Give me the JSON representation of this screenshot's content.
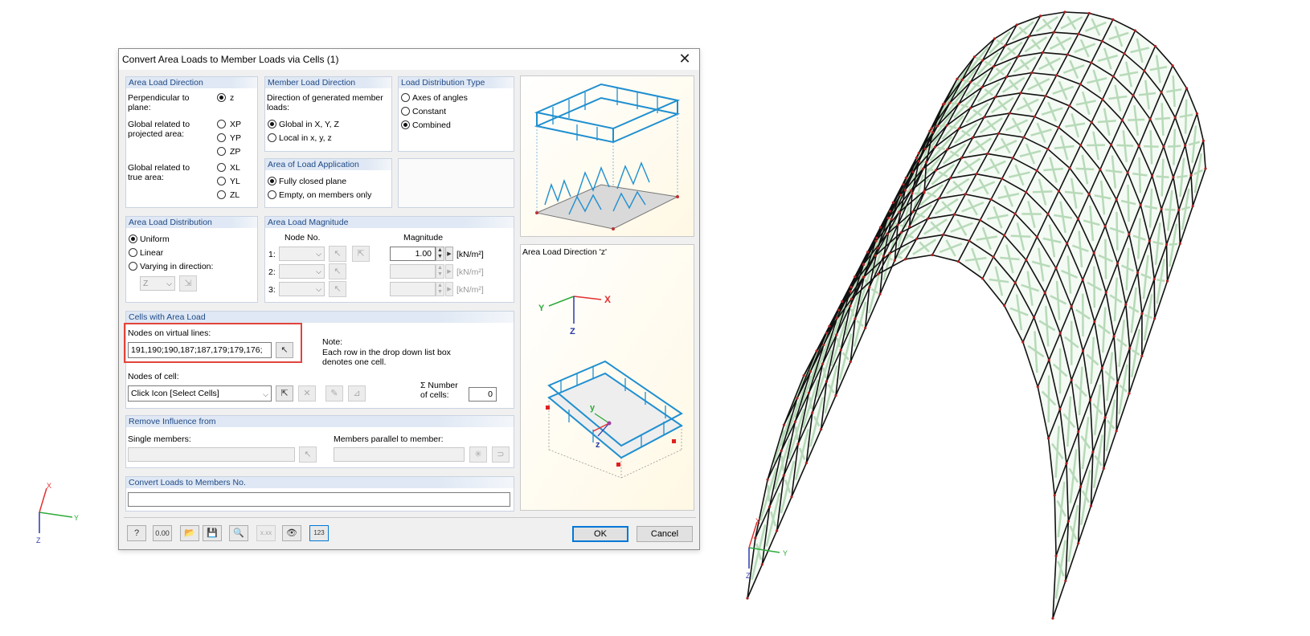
{
  "dialog": {
    "title": "Convert Area Loads to Member Loads via Cells   (1)",
    "close_glyph": "✕"
  },
  "area_load_direction": {
    "header": "Area Load Direction",
    "perpendicular_label": "Perpendicular to plane:",
    "z_option": "z",
    "global_projected_label": "Global related to projected area:",
    "projected_options": [
      "XP",
      "YP",
      "ZP"
    ],
    "global_true_label": "Global related to true area:",
    "true_options": [
      "XL",
      "YL",
      "ZL"
    ],
    "selected": "z"
  },
  "member_load_direction": {
    "header": "Member Load Direction",
    "description": "Direction of generated member loads:",
    "options": [
      "Global in X, Y, Z",
      "Local in x, y, z"
    ],
    "selected": "Global in X, Y, Z"
  },
  "load_distribution_type": {
    "header": "Load Distribution Type",
    "options": [
      "Axes of angles",
      "Constant",
      "Combined"
    ],
    "selected": "Combined"
  },
  "area_of_load_application": {
    "header": "Area of Load Application",
    "options": [
      "Fully closed plane",
      "Empty, on members only"
    ],
    "selected": "Fully closed plane"
  },
  "area_load_distribution": {
    "header": "Area Load Distribution",
    "options": [
      "Uniform",
      "Linear",
      "Varying in direction:"
    ],
    "selected": "Uniform",
    "direction_value": "Z"
  },
  "area_load_magnitude": {
    "header": "Area Load Magnitude",
    "node_no_header": "Node No.",
    "magnitude_header": "Magnitude",
    "rows": [
      {
        "index": "1:",
        "magnitude": "1.00",
        "unit": "[kN/m²]"
      },
      {
        "index": "2:",
        "magnitude": "",
        "unit": "[kN/m²]"
      },
      {
        "index": "3:",
        "magnitude": "",
        "unit": "[kN/m²]"
      }
    ]
  },
  "cells_with_area_load": {
    "header": "Cells with Area Load",
    "nodes_virtual_label": "Nodes on virtual lines:",
    "nodes_virtual_value": "191,190;190,187;187,179;179,176;",
    "note_title": "Note:",
    "note_text_1": "Each row in the drop down list box",
    "note_text_2": "denotes one cell.",
    "nodes_of_cell_label": "Nodes of cell:",
    "nodes_of_cell_value": "Click Icon [Select Cells]",
    "number_label_1": "Σ Number",
    "number_label_2": "of cells:",
    "number_value": "0"
  },
  "remove_influence": {
    "header": "Remove Influence from",
    "single_members_label": "Single members:",
    "parallel_label": "Members parallel to member:"
  },
  "convert_loads": {
    "header": "Convert Loads to Members No."
  },
  "preview": {
    "caption": "Area Load Direction 'z'",
    "axis_x": "X",
    "axis_y": "Y",
    "axis_z": "Z",
    "local_y": "y",
    "local_z": "z"
  },
  "footer": {
    "ok": "OK",
    "cancel": "Cancel",
    "tool_icons": [
      "help-icon",
      "units-icon",
      "open-icon",
      "save-icon",
      "search-icon",
      "decimal-icon",
      "view-icon",
      "numbering-icon"
    ],
    "tool_glyphs": [
      "?",
      "0.00",
      "📂",
      "💾",
      "🔍",
      "x.xx",
      "👁",
      "123"
    ]
  },
  "axes_left": {
    "x": "X",
    "y": "Y",
    "z": "Z"
  },
  "axes_right": {
    "x": "X",
    "y": "Y",
    "z": "Z"
  },
  "colors": {
    "accent": "#0078d7",
    "header_text": "#204a87",
    "highlight": "#e2443c",
    "load_blue": "#1f8fd0",
    "mesh_green": "#b7dab8"
  }
}
